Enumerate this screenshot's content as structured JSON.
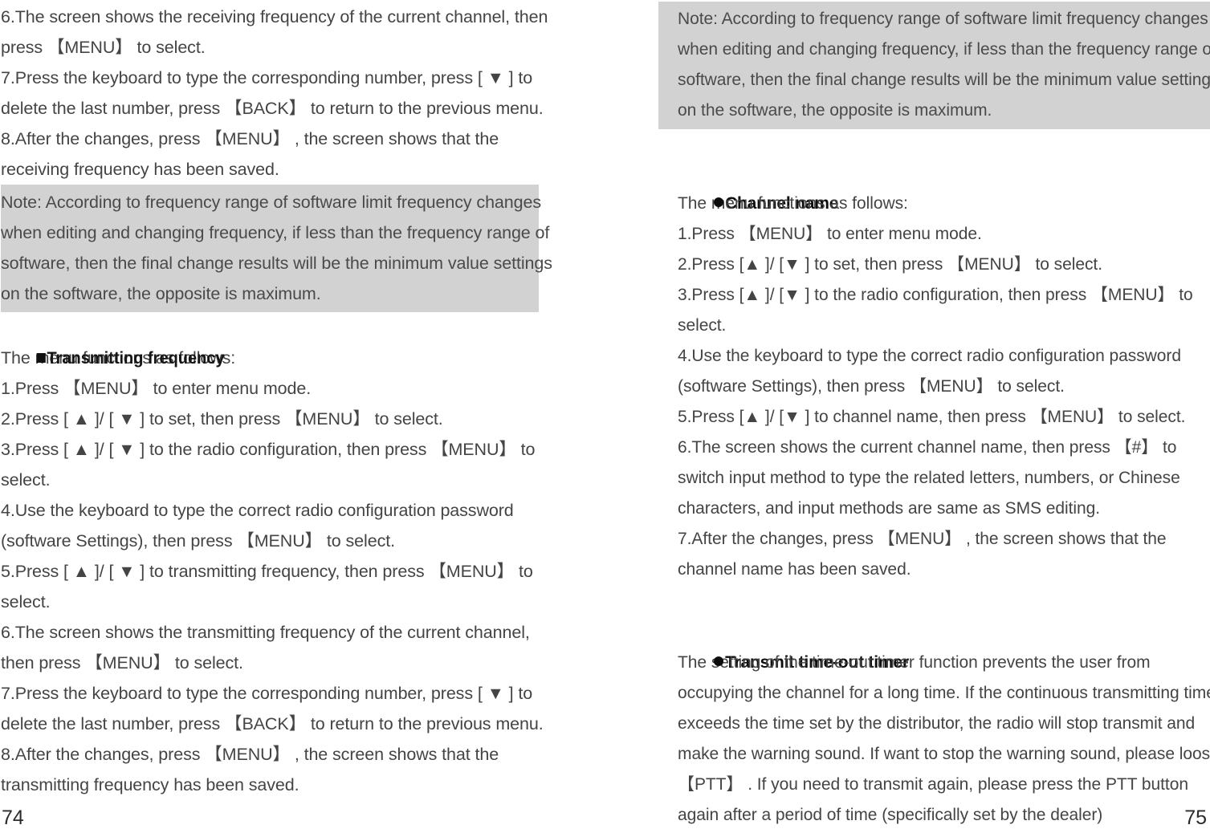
{
  "document": {
    "type": "two-up scanned manual spread",
    "note_background_color": "#d2d2d2",
    "text_color": "#444444"
  },
  "left_page": {
    "page_number": "74",
    "blocks": [
      {
        "kind": "paragraph",
        "lines": [
          "6.The screen shows the receiving frequency of the current channel, then",
          "press 【MENU】 to select.",
          "7.Press the keyboard to type the corresponding number, press [ ▼ ] to",
          "delete the last number, press 【BACK】 to return to the previous menu.",
          "8.After the changes, press 【MENU】 , the screen shows that the",
          "receiving frequency has been saved."
        ]
      },
      {
        "kind": "note",
        "lines": [
          "Note: According to frequency range of software limit frequency changes",
          "when editing and changing frequency, if less than the frequency range of",
          "software, then the final change results will be the minimum value settings",
          "on the software, the opposite is maximum."
        ]
      },
      {
        "kind": "heading-square",
        "bullet": "square-bullet-icon",
        "text": "Transmitting frequency"
      },
      {
        "kind": "paragraph",
        "lines": [
          "The menu functions as follows:",
          "1.Press 【MENU】 to enter menu mode.",
          "2.Press [ ▲ ]/ [ ▼ ] to set, then press 【MENU】 to select.",
          "3.Press [ ▲ ]/ [ ▼ ] to the radio configuration, then press 【MENU】 to",
          "select.",
          "4.Use the keyboard to type the correct radio configuration password",
          "(software Settings), then press 【MENU】 to select.",
          "5.Press [ ▲ ]/ [ ▼ ] to transmitting frequency, then press 【MENU】 to",
          "select.",
          "6.The screen shows the transmitting frequency of the current channel,",
          "then press 【MENU】 to select.",
          "7.Press the keyboard to type the corresponding number, press [ ▼ ] to",
          "delete the last number, press 【BACK】 to return to the previous menu.",
          "8.After the changes, press 【MENU】 , the screen shows that the",
          "transmitting frequency has been saved."
        ]
      }
    ]
  },
  "right_page": {
    "page_number": "75",
    "blocks": [
      {
        "kind": "note",
        "lines": [
          "Note: According to frequency range of software limit frequency changes",
          "when editing and changing frequency, if less than the frequency range of",
          "software, then the final change results will be the minimum value settings",
          "on the software, the opposite is maximum."
        ]
      },
      {
        "kind": "heading-dot",
        "bullet": "round-bullet-icon",
        "text": "Channel name"
      },
      {
        "kind": "paragraph",
        "lines": [
          "The menu functions as follows:",
          "1.Press 【MENU】 to enter menu mode.",
          "2.Press [▲ ]/ [▼ ] to set, then press 【MENU】 to select.",
          "3.Press [▲ ]/ [▼ ] to the radio configuration, then press 【MENU】 to",
          "select.",
          "4.Use the keyboard to type the correct radio configuration password",
          "(software Settings), then press 【MENU】 to select.",
          "5.Press [▲ ]/ [▼ ] to channel name, then press 【MENU】 to select.",
          "6.The screen shows the current channel name, then press 【#】 to",
          "switch input method to type the related letters, numbers, or Chinese",
          "characters, and input methods are same as SMS editing.",
          "7.After the changes, press 【MENU】 , the screen shows that the",
          "channel name has been saved."
        ]
      },
      {
        "kind": "heading-dot",
        "bullet": "round-bullet-icon",
        "text": "Transmit time-out timer"
      },
      {
        "kind": "paragraph",
        "lines": [
          "The setting of the time-out timer function prevents the user from",
          "occupying the channel for a long time. If the continuous transmitting time",
          "exceeds the time set by the distributor, the radio will stop transmit and",
          "make the warning sound. If want to stop the warning sound, please loose",
          "【PTT】 . If you need to transmit again, please press the PTT button",
          "again after a period of time (specifically set by the dealer)"
        ]
      }
    ]
  }
}
